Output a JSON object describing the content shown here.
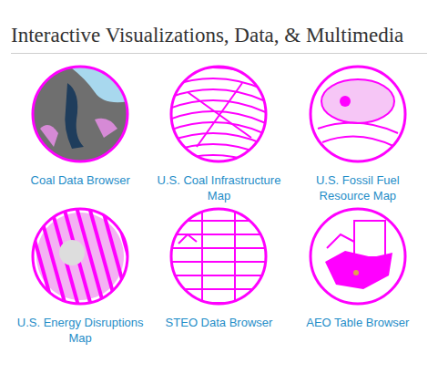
{
  "heading": "Interactive Visualizations, Data, & Multimedia",
  "items": [
    {
      "label": "Coal Data Browser"
    },
    {
      "label": "U.S. Coal Infrastructure Map"
    },
    {
      "label": "U.S. Fossil Fuel Resource Map"
    },
    {
      "label": "U.S. Energy Disruptions Map"
    },
    {
      "label": "STEO Data Browser"
    },
    {
      "label": "AEO Table Browser"
    }
  ]
}
